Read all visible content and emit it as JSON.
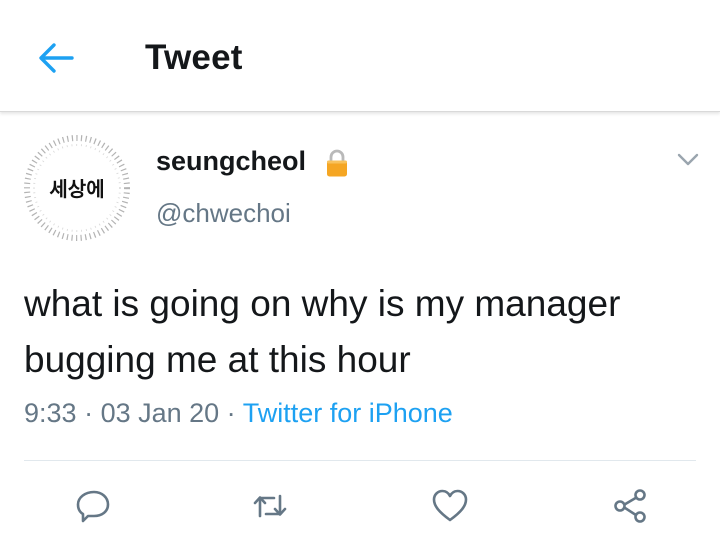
{
  "header": {
    "title": "Tweet"
  },
  "tweet": {
    "avatar_text": "세상에",
    "display_name": "seungcheol",
    "handle": "@chwechoi",
    "text": "what is going on why is my manager bugging me at this hour",
    "time": "9:33",
    "date": "03 Jan 20",
    "source": "Twitter for iPhone",
    "separator": " · "
  },
  "icons": {
    "back": "back-arrow-icon",
    "lock": "lock-icon",
    "caret": "chevron-down-icon",
    "reply": "reply-icon",
    "retweet": "retweet-icon",
    "like": "heart-icon",
    "share": "share-icon"
  },
  "colors": {
    "accent": "#1da1f2",
    "secondary_text": "#657786",
    "primary_text": "#14171a",
    "lock": "#f5a623",
    "action_icon": "#657786"
  }
}
